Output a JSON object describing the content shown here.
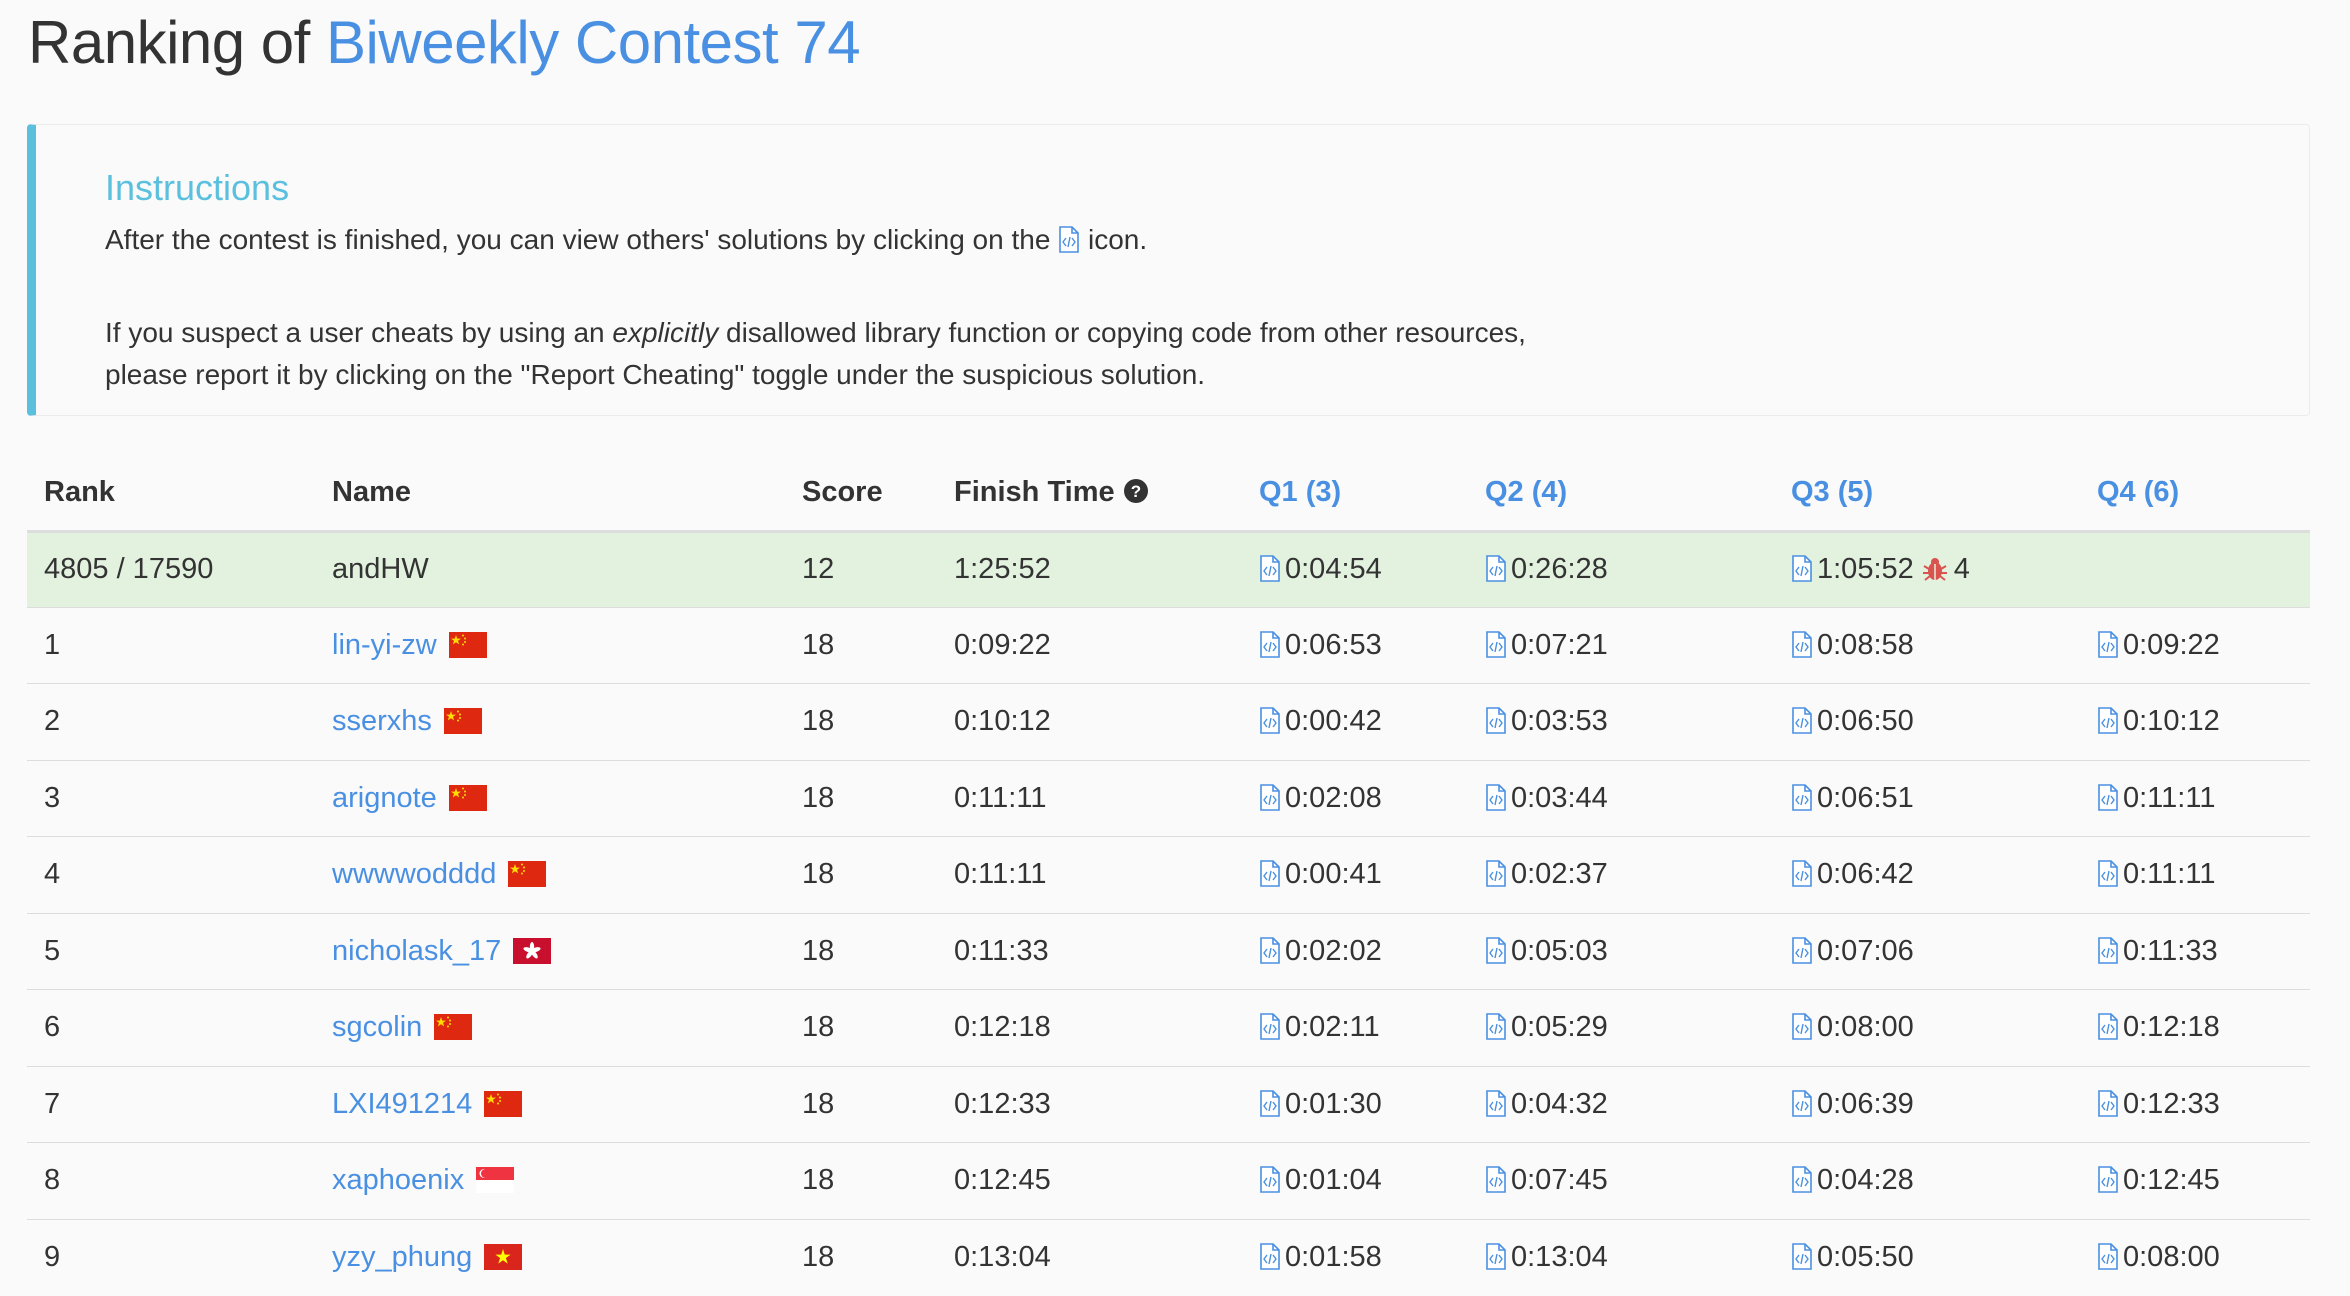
{
  "title": {
    "prefix": "Ranking of ",
    "contest": "Biweekly Contest 74"
  },
  "instructions": {
    "heading": "Instructions",
    "line1_before": "After the contest is finished, you can view others' solutions by clicking on the",
    "line1_after": "icon.",
    "line2_a": "If you suspect a user cheats by using an ",
    "line2_em": "explicitly",
    "line2_b": " disallowed library function or copying code from other resources,",
    "line3": "please report it by clicking on the \"Report Cheating\" toggle under the suspicious solution."
  },
  "table": {
    "headers": {
      "rank": "Rank",
      "name": "Name",
      "score": "Score",
      "finish": "Finish Time",
      "q1": "Q1 (3)",
      "q2": "Q2 (4)",
      "q3": "Q3 (5)",
      "q4": "Q4 (6)"
    },
    "me": {
      "rank": "4805 / 17590",
      "name": "andHW",
      "score": "12",
      "finish": "1:25:52",
      "q1": "0:04:54",
      "q2": "0:26:28",
      "q3": "1:05:52",
      "q3_bugs": "4",
      "q4": ""
    },
    "rows": [
      {
        "rank": "1",
        "name": "lin-yi-zw",
        "flag": "cn",
        "score": "18",
        "finish": "0:09:22",
        "q1": "0:06:53",
        "q2": "0:07:21",
        "q3": "0:08:58",
        "q4": "0:09:22"
      },
      {
        "rank": "2",
        "name": "sserxhs",
        "flag": "cn",
        "score": "18",
        "finish": "0:10:12",
        "q1": "0:00:42",
        "q2": "0:03:53",
        "q3": "0:06:50",
        "q4": "0:10:12"
      },
      {
        "rank": "3",
        "name": "arignote",
        "flag": "cn",
        "score": "18",
        "finish": "0:11:11",
        "q1": "0:02:08",
        "q2": "0:03:44",
        "q3": "0:06:51",
        "q4": "0:11:11"
      },
      {
        "rank": "4",
        "name": "wwwwodddd",
        "flag": "cn",
        "score": "18",
        "finish": "0:11:11",
        "q1": "0:00:41",
        "q2": "0:02:37",
        "q3": "0:06:42",
        "q4": "0:11:11"
      },
      {
        "rank": "5",
        "name": "nicholask_17",
        "flag": "hk",
        "score": "18",
        "finish": "0:11:33",
        "q1": "0:02:02",
        "q2": "0:05:03",
        "q3": "0:07:06",
        "q4": "0:11:33"
      },
      {
        "rank": "6",
        "name": "sgcolin",
        "flag": "cn",
        "score": "18",
        "finish": "0:12:18",
        "q1": "0:02:11",
        "q2": "0:05:29",
        "q3": "0:08:00",
        "q4": "0:12:18"
      },
      {
        "rank": "7",
        "name": "LXI491214",
        "flag": "cn",
        "score": "18",
        "finish": "0:12:33",
        "q1": "0:01:30",
        "q2": "0:04:32",
        "q3": "0:06:39",
        "q4": "0:12:33"
      },
      {
        "rank": "8",
        "name": "xaphoenix",
        "flag": "sg",
        "score": "18",
        "finish": "0:12:45",
        "q1": "0:01:04",
        "q2": "0:07:45",
        "q3": "0:04:28",
        "q4": "0:12:45"
      },
      {
        "rank": "9",
        "name": "yzy_phung",
        "flag": "vn",
        "score": "18",
        "finish": "0:13:04",
        "q1": "0:01:58",
        "q2": "0:13:04",
        "q3": "0:05:50",
        "q4": "0:08:00"
      }
    ]
  },
  "icons": {
    "code": "code-file-icon",
    "bug": "bug-icon",
    "help": "question-circle-icon"
  },
  "colors": {
    "link": "#4a90e2",
    "callout": "#5bc0de",
    "highlight": "#e3f1df",
    "bug": "#d9534f"
  }
}
